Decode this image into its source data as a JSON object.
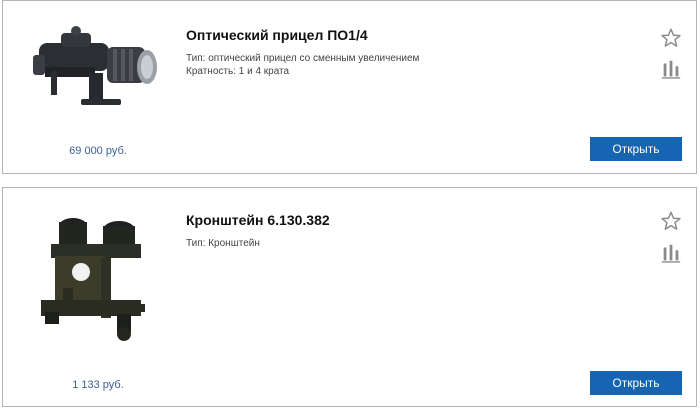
{
  "products": [
    {
      "title": "Оптический прицел ПО1/4",
      "attributes": [
        "Тип: оптический прицел со сменным увеличением",
        "Кратность: 1 и 4 крата"
      ],
      "price": "69 000 руб.",
      "button_label": "Открыть",
      "icons": [
        "star-icon",
        "bar-chart-icon"
      ]
    },
    {
      "title": "Кронштейн 6.130.382",
      "attributes": [
        "Тип: Кронштейн"
      ],
      "price": "1 133 руб.",
      "button_label": "Открыть",
      "icons": [
        "star-icon",
        "bar-chart-icon"
      ]
    }
  ],
  "colors": {
    "button_bg": "#1565b3",
    "price_text": "#3a5f9a",
    "icon_gray": "#8a8a8a",
    "card_border": "#b5b5b5"
  }
}
